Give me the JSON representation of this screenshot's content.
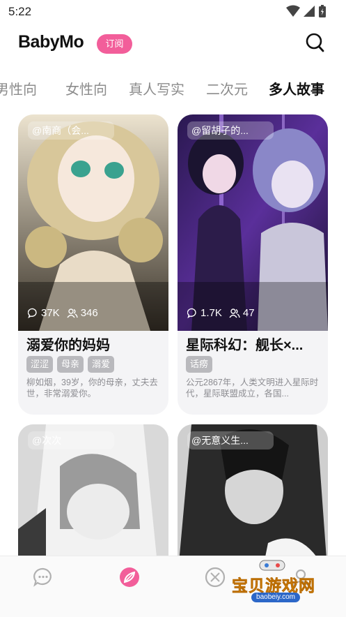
{
  "status_bar": {
    "time": "5:22"
  },
  "header": {
    "logo_text": "BabyMo",
    "subscribe_label": "订阅"
  },
  "tabs": [
    {
      "label": "男性向"
    },
    {
      "label": "女性向"
    },
    {
      "label": "真人写实"
    },
    {
      "label": "二次元"
    },
    {
      "label": "多人故事"
    }
  ],
  "active_tab": "多人故事",
  "cards": [
    {
      "author": "@南商（会...",
      "comments": "37K",
      "users": "346",
      "title": "溺爱你的妈妈",
      "tags": [
        "涩涩",
        "母亲",
        "溺爱"
      ],
      "description": "柳如烟，39岁，你的母亲，丈夫去世，非常溺爱你。"
    },
    {
      "author": "@留胡子的...",
      "comments": "1.7K",
      "users": "47",
      "title": "星际科幻：舰长×...",
      "tags": [
        "话痨"
      ],
      "description": "公元2867年，人类文明进入星际时代，星际联盟成立，各国..."
    },
    {
      "author": "@次次"
    },
    {
      "author": "@无意义生..."
    }
  ],
  "watermark": {
    "text": "宝贝游戏网",
    "url": "baobeiy.com"
  },
  "colors": {
    "accent": "#f25e9a",
    "tag_bg": "#b9b9bd",
    "card_bg": "#f4f4f6"
  }
}
